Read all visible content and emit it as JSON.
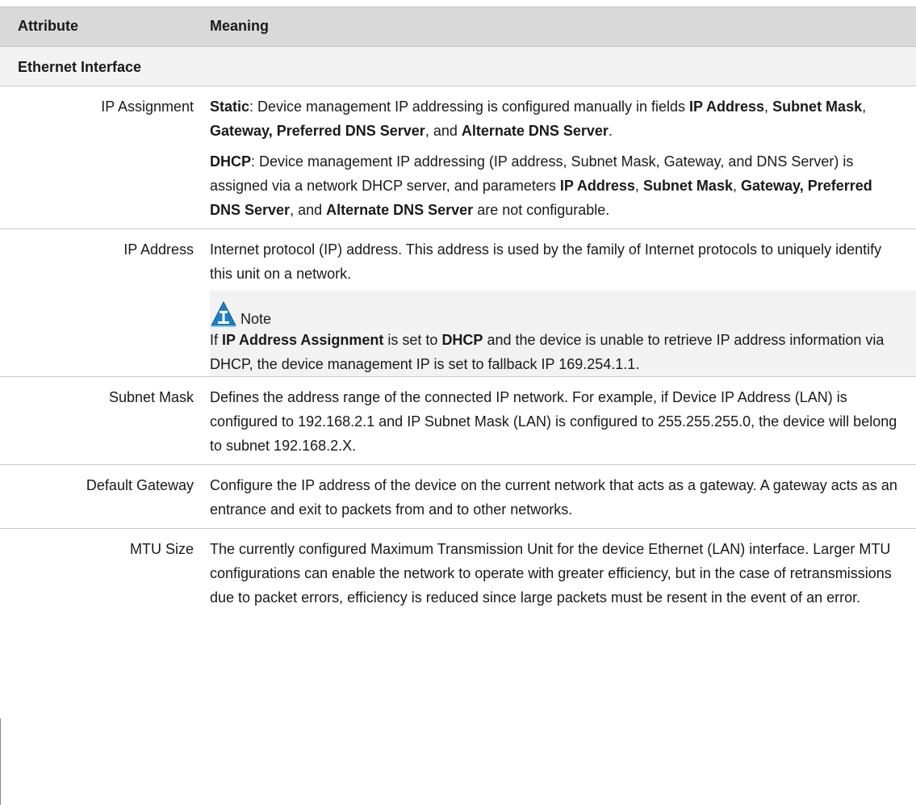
{
  "table": {
    "headers": [
      "Attribute",
      "Meaning"
    ],
    "section": "Ethernet Interface",
    "rows": {
      "ip_assignment": {
        "attribute": "IP Assignment",
        "static": {
          "label": "Static",
          "t1": ":  Device management IP addressing is configured manually in fields ",
          "b1": "IP Address",
          "t2": ", ",
          "b2": "Subnet Mask",
          "t3": ", ",
          "b3": "Gateway, Preferred DNS Server",
          "t4": ", and ",
          "b4": "Alternate DNS Server",
          "t5": "."
        },
        "dhcp": {
          "label": "DHCP",
          "t1": ":  Device management IP addressing (IP address, Subnet Mask, Gateway, and DNS Server) is assigned via a network DHCP server, and parameters ",
          "b1": "IP Address",
          "t2": ", ",
          "b2": "Subnet Mask",
          "t3": ", ",
          "b3": "Gateway, Preferred DNS Server",
          "t4": ", and ",
          "b4": "Alternate DNS Server",
          "t5": " are not configurable."
        }
      },
      "ip_address": {
        "attribute": "IP Address",
        "meaning": "Internet protocol (IP) address. This address is used by the family of Internet protocols to uniquely identify this unit on a network.",
        "note": {
          "label": "Note",
          "t1": "If ",
          "b1": "IP Address Assignment",
          "t2": " is set to ",
          "b2": "DHCP",
          "t3": " and the device is unable to retrieve IP address information via DHCP, the device management IP is set to fallback IP 169.254.1.1."
        }
      },
      "subnet_mask": {
        "attribute": "Subnet Mask",
        "meaning": "Defines the address range of the connected IP network. For example, if Device IP Address (LAN) is configured to 192.168.2.1 and IP Subnet Mask (LAN) is configured to 255.255.255.0, the device will belong to subnet 192.168.2.X."
      },
      "default_gateway": {
        "attribute": "Default Gateway",
        "meaning": "Configure the IP address of the device on the current network that acts as a gateway. A gateway acts as an entrance and exit to packets from and to other networks."
      },
      "mtu_size": {
        "attribute": "MTU Size",
        "meaning": "The currently configured Maximum Transmission Unit for the device Ethernet (LAN) interface. Larger MTU configurations can enable the network to operate with greater efficiency, but in the case of retransmissions due to packet errors, efficiency is reduced since large packets must be resent in the event of an error."
      }
    }
  },
  "colors": {
    "header_bg": "#d9d9d9",
    "section_bg": "#f2f2f2",
    "note_bg": "#f2f2f2",
    "note_icon": "#1e7fc0",
    "border": "#c8c8c8"
  },
  "icons": {
    "note": "note-triangle-icon"
  }
}
